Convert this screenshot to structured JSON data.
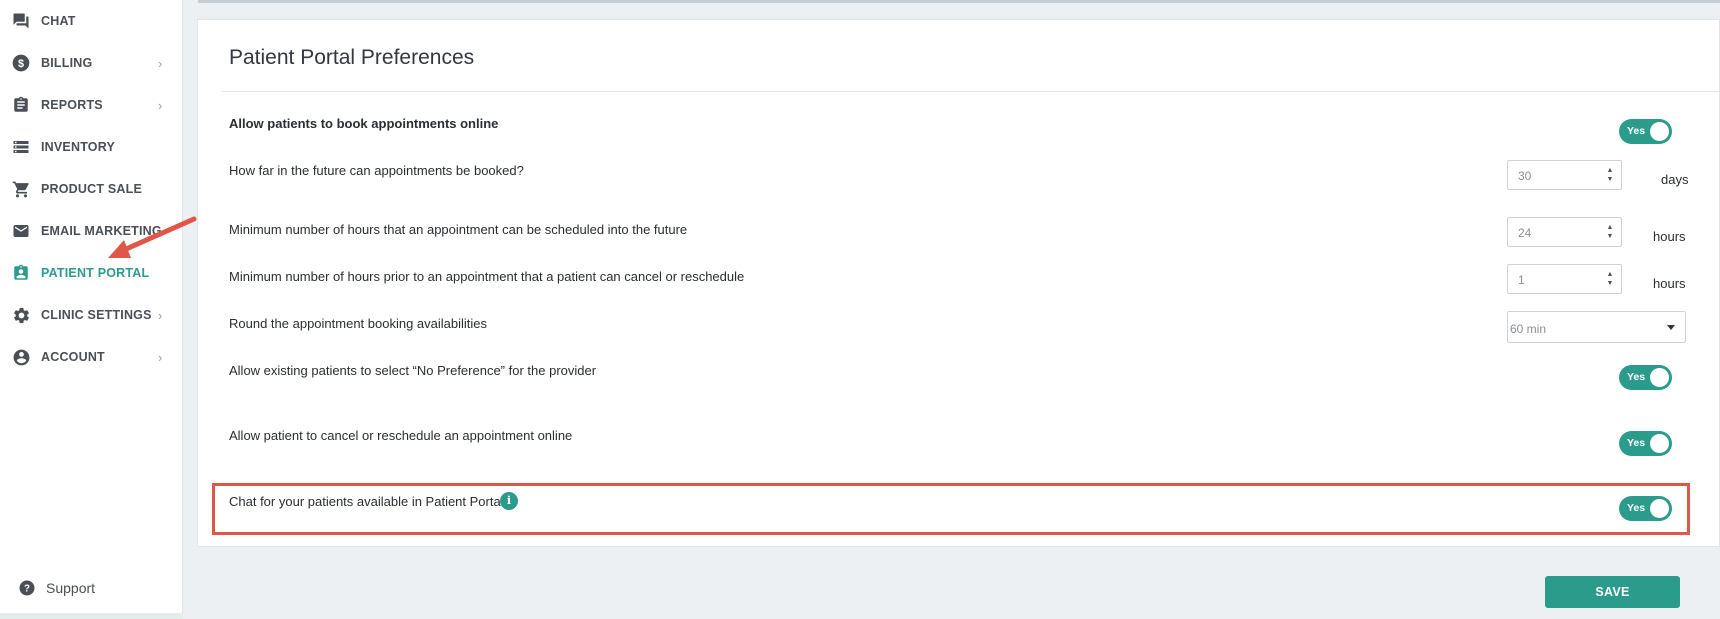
{
  "sidebar": {
    "items": [
      {
        "label": "CHAT",
        "icon": "chat-icon",
        "has_chevron": false,
        "active": false
      },
      {
        "label": "BILLING",
        "icon": "dollar-icon",
        "has_chevron": true,
        "active": false
      },
      {
        "label": "REPORTS",
        "icon": "clipboard-icon",
        "has_chevron": true,
        "active": false
      },
      {
        "label": "INVENTORY",
        "icon": "storage-icon",
        "has_chevron": false,
        "active": false
      },
      {
        "label": "PRODUCT SALE",
        "icon": "cart-icon",
        "has_chevron": false,
        "active": false
      },
      {
        "label": "EMAIL MARKETING",
        "icon": "mail-icon",
        "has_chevron": false,
        "active": false
      },
      {
        "label": "PATIENT PORTAL",
        "icon": "badge-icon",
        "has_chevron": false,
        "active": true
      },
      {
        "label": "CLINIC SETTINGS",
        "icon": "gear-icon",
        "has_chevron": true,
        "active": false
      },
      {
        "label": "ACCOUNT",
        "icon": "account-icon",
        "has_chevron": true,
        "active": false
      }
    ],
    "chevron": "›",
    "support_label": "Support"
  },
  "preferences": {
    "title": "Patient Portal Preferences",
    "allow_booking_label": "Allow patients to book appointments online",
    "allow_booking_toggle": "Yes",
    "future_label": "How far in the future can appointments be booked?",
    "future_value": "30",
    "future_unit": "days",
    "min_hours_label": "Minimum number of hours that an appointment can be scheduled into the future",
    "min_hours_value": "24",
    "min_hours_unit": "hours",
    "cancel_hours_label": "Minimum number of hours prior to an appointment that a patient can cancel or reschedule",
    "cancel_hours_value": "1",
    "cancel_hours_unit": "hours",
    "round_label": "Round the appointment booking availabilities",
    "round_value": "60 min",
    "no_pref_label": "Allow existing patients to select “No Preference” for the provider",
    "no_pref_toggle": "Yes",
    "cancel_online_label": "Allow patient to cancel or reschedule an appointment online",
    "cancel_online_toggle": "Yes",
    "chat_label": "Chat for your patients available in Patient Portal",
    "chat_toggle": "Yes"
  },
  "icons": {
    "info": "i",
    "spin_up": "▲",
    "spin_down": "▼"
  },
  "save_label": "SAVE",
  "colors": {
    "accent": "#2b9c8c",
    "highlight": "#e0574a"
  }
}
